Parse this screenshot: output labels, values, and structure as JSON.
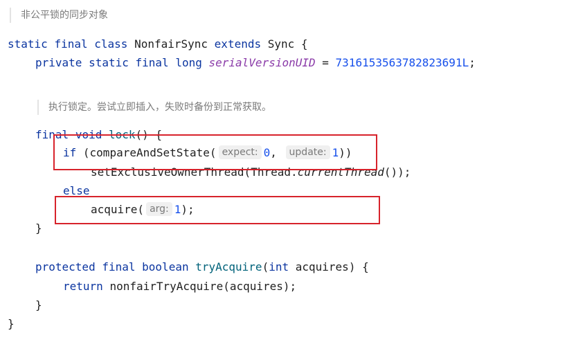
{
  "comments": {
    "class_doc": "非公平锁的同步对象",
    "lock_doc": "执行锁定。尝试立即插入，失败时备份到正常获取。"
  },
  "code": {
    "class_decl": {
      "kw_static": "static",
      "kw_final": "final",
      "kw_class": "class",
      "class_name": "NonfairSync",
      "kw_extends": "extends",
      "super_name": "Sync",
      "open_brace": "{"
    },
    "serial_decl": {
      "kw_private": "private",
      "kw_static": "static",
      "kw_final": "final",
      "kw_long": "long",
      "field_name": "serialVersionUID",
      "equals": "=",
      "value": "7316153563782823691L",
      "semicolon": ";"
    },
    "lock_decl": {
      "kw_final": "final",
      "kw_void": "void",
      "name": "lock",
      "rest": "() {"
    },
    "if_line": {
      "kw_if": "if",
      "call_open": "(compareAndSetState(",
      "hint_expect": "expect:",
      "value_expect": "0",
      "comma": ",",
      "hint_update": "update:",
      "value_update": "1",
      "close": "))"
    },
    "set_owner_line": {
      "call": "setExclusiveOwnerThread(Thread.",
      "static_method": "currentThread",
      "close": "());"
    },
    "else_line": {
      "kw_else": "else"
    },
    "acquire_line": {
      "call_open": "acquire(",
      "hint_arg": "arg:",
      "value_arg": "1",
      "close": ");"
    },
    "lock_close": "}",
    "try_acquire_decl": {
      "kw_protected": "protected",
      "kw_final": "final",
      "kw_boolean": "boolean",
      "method_name": "tryAcquire",
      "open_paren": "(",
      "kw_int": "int",
      "param": "acquires) {"
    },
    "return_line": {
      "kw_return": "return",
      "expr": "nonfairTryAcquire(acquires);"
    },
    "try_close": "}",
    "class_close": "}"
  },
  "highlight_color": "#d7222b",
  "colors": {
    "keyword": "#0b35a0",
    "number": "#1750eb",
    "field": "#8a3aa8",
    "method_decl": "#00627a",
    "comment": "#7a7a7a"
  }
}
